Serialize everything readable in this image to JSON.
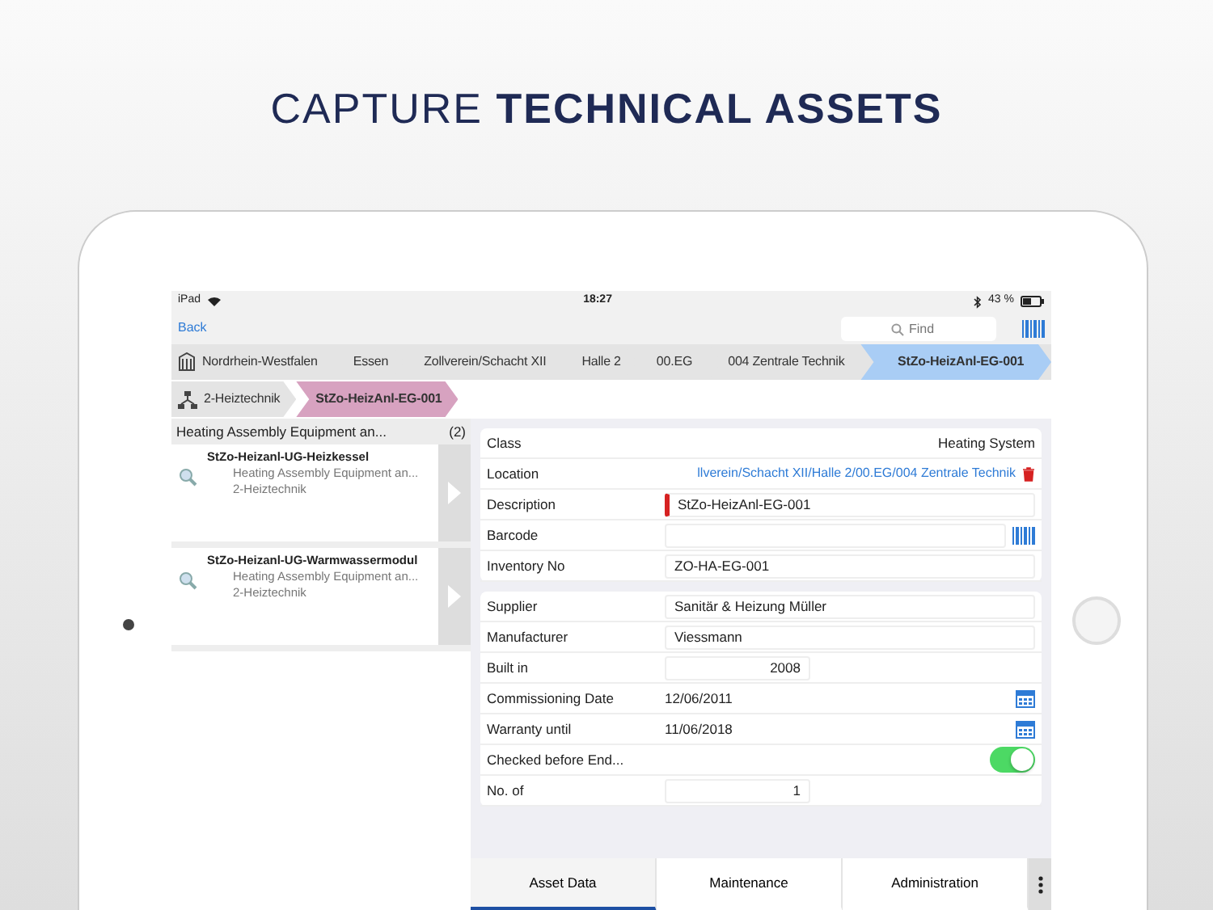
{
  "headline": "CAPTURE **TECHNICAL ASSETS**",
  "status_bar": {
    "device": "iPad",
    "time": "18:27",
    "battery": "43 %"
  },
  "nav": {
    "back": "Back",
    "search": {
      "placeholder": "Find"
    }
  },
  "location_path": [
    {
      "label": "Nordrhein-Westfalen",
      "selected": false
    },
    {
      "label": "Essen",
      "selected": false
    },
    {
      "label": "Zollverein/Schacht XII",
      "selected": false
    },
    {
      "label": "Halle 2",
      "selected": false
    },
    {
      "label": "00.EG",
      "selected": false
    },
    {
      "label": "004 Zentrale Technik",
      "selected": false
    },
    {
      "label": "StZo-HeizAnl-EG-001",
      "selected": true
    }
  ],
  "group_path": [
    {
      "label": "2-Heiztechnik",
      "selected": false
    },
    {
      "label": "StZo-HeizAnl-EG-001",
      "selected": true
    }
  ],
  "list": {
    "title": "Heating Assembly Equipment an...",
    "count": "(2)",
    "items": [
      {
        "name": "StZo-Heizanl-UG-Heizkessel",
        "class": "Heating Assembly Equipment an...",
        "group": "2-Heiztechnik"
      },
      {
        "name": "StZo-Heizanl-UG-Warmwassermodul",
        "class": "Heating Assembly Equipment an...",
        "group": "2-Heiztechnik"
      }
    ]
  },
  "sections": [
    [
      {
        "kind": "text",
        "label": "Class",
        "value": "Heating System"
      },
      {
        "kind": "link",
        "label": "Location",
        "value": "llverein/Schacht XII/Halle 2/00.EG/004 Zentrale Technik"
      },
      {
        "kind": "input",
        "label": "Description",
        "value": "StZo-HeizAnl-EG-001",
        "required": true
      },
      {
        "kind": "barcode",
        "label": "Barcode"
      },
      {
        "kind": "input",
        "label": "Inventory No",
        "value": "ZO-HA-EG-001",
        "required": false
      }
    ],
    [
      {
        "kind": "input",
        "label": "Supplier",
        "value": "Sanitär & Heizung Müller",
        "required": false
      },
      {
        "kind": "input",
        "label": "Manufacturer",
        "value": "Viessmann",
        "required": false
      },
      {
        "kind": "number",
        "label": "Built in",
        "value": "2008"
      },
      {
        "kind": "date",
        "label": "Commissioning Date",
        "value": "12/06/2011"
      },
      {
        "kind": "date",
        "label": "Warranty until",
        "value": "11/06/2018"
      },
      {
        "kind": "toggle",
        "label": "Checked before End...",
        "on": true
      },
      {
        "kind": "number",
        "label": "No. of",
        "value": "1"
      }
    ]
  ],
  "tabs": [
    {
      "label": "Asset Data",
      "selected": true
    },
    {
      "label": "Maintenance",
      "selected": false
    },
    {
      "label": "Administration",
      "selected": false
    }
  ]
}
